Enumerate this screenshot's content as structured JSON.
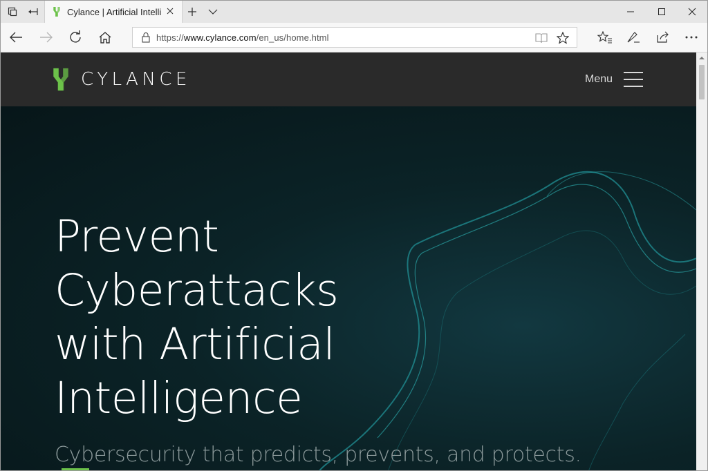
{
  "browser": {
    "tab": {
      "title": "Cylance | Artificial Intelli"
    },
    "address": {
      "scheme": "https://",
      "host": "www.cylance.com",
      "path": "/en_us/home.html"
    }
  },
  "site": {
    "brand": "CYLANCE",
    "menu_label": "Menu",
    "hero": {
      "headline_lines": [
        "Prevent",
        "Cyberattacks",
        "with Artificial",
        "Intelligence"
      ],
      "subhead": "Cybersecurity that predicts, prevents, and protects."
    }
  },
  "colors": {
    "header_bg": "#2a2a2a",
    "hero_bg": "#0d2226",
    "brand_green": "#6cc24a",
    "accent_teal": "#2fb5b8"
  }
}
